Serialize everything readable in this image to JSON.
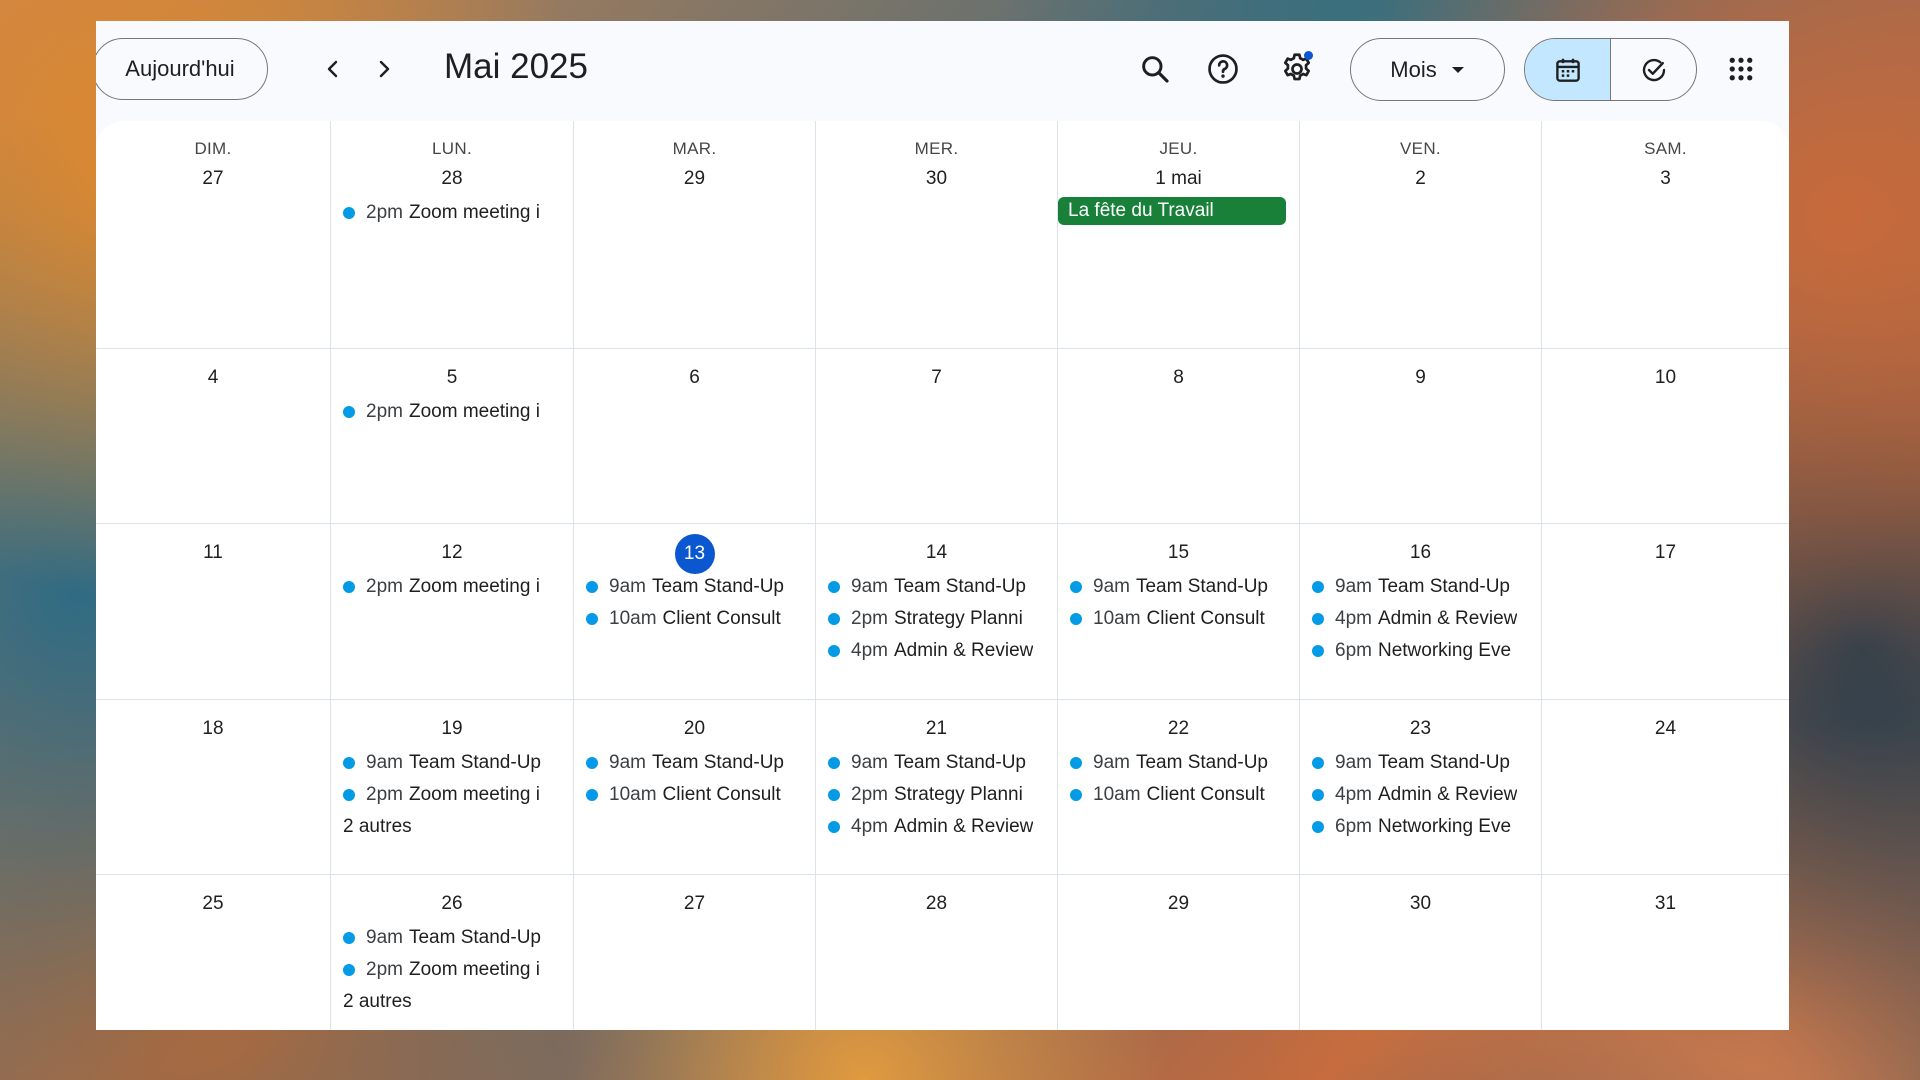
{
  "toolbar": {
    "today_label": "Aujourd'hui",
    "title": "Mai 2025",
    "view_label": "Mois",
    "icons": [
      "chevron-left-icon",
      "chevron-right-icon",
      "search-icon",
      "help-icon",
      "settings-icon",
      "caret-down-icon",
      "calendar-icon",
      "tasks-icon",
      "apps-grid-icon"
    ]
  },
  "colors": {
    "accent": "#0b57d0",
    "event_dot": "#039be5",
    "holiday": "#188038",
    "selected_segment": "#c2e7ff"
  },
  "weekdays": [
    "DIM.",
    "LUN.",
    "MAR.",
    "MER.",
    "JEU.",
    "VEN.",
    "SAM."
  ],
  "weeks": [
    [
      {
        "day": "27",
        "events": []
      },
      {
        "day": "28",
        "events": [
          {
            "time": "2pm",
            "title": "Zoom meeting i"
          }
        ]
      },
      {
        "day": "29",
        "events": []
      },
      {
        "day": "30",
        "events": []
      },
      {
        "day": "1 mai",
        "allday": "La fête du Travail",
        "events": []
      },
      {
        "day": "2",
        "events": []
      },
      {
        "day": "3",
        "events": []
      }
    ],
    [
      {
        "day": "4",
        "events": []
      },
      {
        "day": "5",
        "events": [
          {
            "time": "2pm",
            "title": "Zoom meeting i"
          }
        ]
      },
      {
        "day": "6",
        "events": []
      },
      {
        "day": "7",
        "events": []
      },
      {
        "day": "8",
        "events": []
      },
      {
        "day": "9",
        "events": []
      },
      {
        "day": "10",
        "events": []
      }
    ],
    [
      {
        "day": "11",
        "events": []
      },
      {
        "day": "12",
        "events": [
          {
            "time": "2pm",
            "title": "Zoom meeting i"
          }
        ]
      },
      {
        "day": "13",
        "today": true,
        "events": [
          {
            "time": "9am",
            "title": "Team Stand-Up"
          },
          {
            "time": "10am",
            "title": "Client Consult"
          }
        ]
      },
      {
        "day": "14",
        "events": [
          {
            "time": "9am",
            "title": "Team Stand-Up"
          },
          {
            "time": "2pm",
            "title": "Strategy Planni"
          },
          {
            "time": "4pm",
            "title": "Admin & Review"
          }
        ]
      },
      {
        "day": "15",
        "events": [
          {
            "time": "9am",
            "title": "Team Stand-Up"
          },
          {
            "time": "10am",
            "title": "Client Consult"
          }
        ]
      },
      {
        "day": "16",
        "events": [
          {
            "time": "9am",
            "title": "Team Stand-Up"
          },
          {
            "time": "4pm",
            "title": "Admin & Review"
          },
          {
            "time": "6pm",
            "title": "Networking Eve"
          }
        ]
      },
      {
        "day": "17",
        "events": []
      }
    ],
    [
      {
        "day": "18",
        "events": []
      },
      {
        "day": "19",
        "events": [
          {
            "time": "9am",
            "title": "Team Stand-Up"
          },
          {
            "time": "2pm",
            "title": "Zoom meeting i"
          }
        ],
        "more": "2 autres"
      },
      {
        "day": "20",
        "events": [
          {
            "time": "9am",
            "title": "Team Stand-Up"
          },
          {
            "time": "10am",
            "title": "Client Consult"
          }
        ]
      },
      {
        "day": "21",
        "events": [
          {
            "time": "9am",
            "title": "Team Stand-Up"
          },
          {
            "time": "2pm",
            "title": "Strategy Planni"
          },
          {
            "time": "4pm",
            "title": "Admin & Review"
          }
        ]
      },
      {
        "day": "22",
        "events": [
          {
            "time": "9am",
            "title": "Team Stand-Up"
          },
          {
            "time": "10am",
            "title": "Client Consult"
          }
        ]
      },
      {
        "day": "23",
        "events": [
          {
            "time": "9am",
            "title": "Team Stand-Up"
          },
          {
            "time": "4pm",
            "title": "Admin & Review"
          },
          {
            "time": "6pm",
            "title": "Networking Eve"
          }
        ]
      },
      {
        "day": "24",
        "events": []
      }
    ],
    [
      {
        "day": "25",
        "events": []
      },
      {
        "day": "26",
        "events": [
          {
            "time": "9am",
            "title": "Team Stand-Up"
          },
          {
            "time": "2pm",
            "title": "Zoom meeting i"
          }
        ],
        "more": "2 autres"
      },
      {
        "day": "27",
        "events": []
      },
      {
        "day": "28",
        "events": []
      },
      {
        "day": "29",
        "events": []
      },
      {
        "day": "30",
        "events": []
      },
      {
        "day": "31",
        "events": []
      }
    ]
  ]
}
